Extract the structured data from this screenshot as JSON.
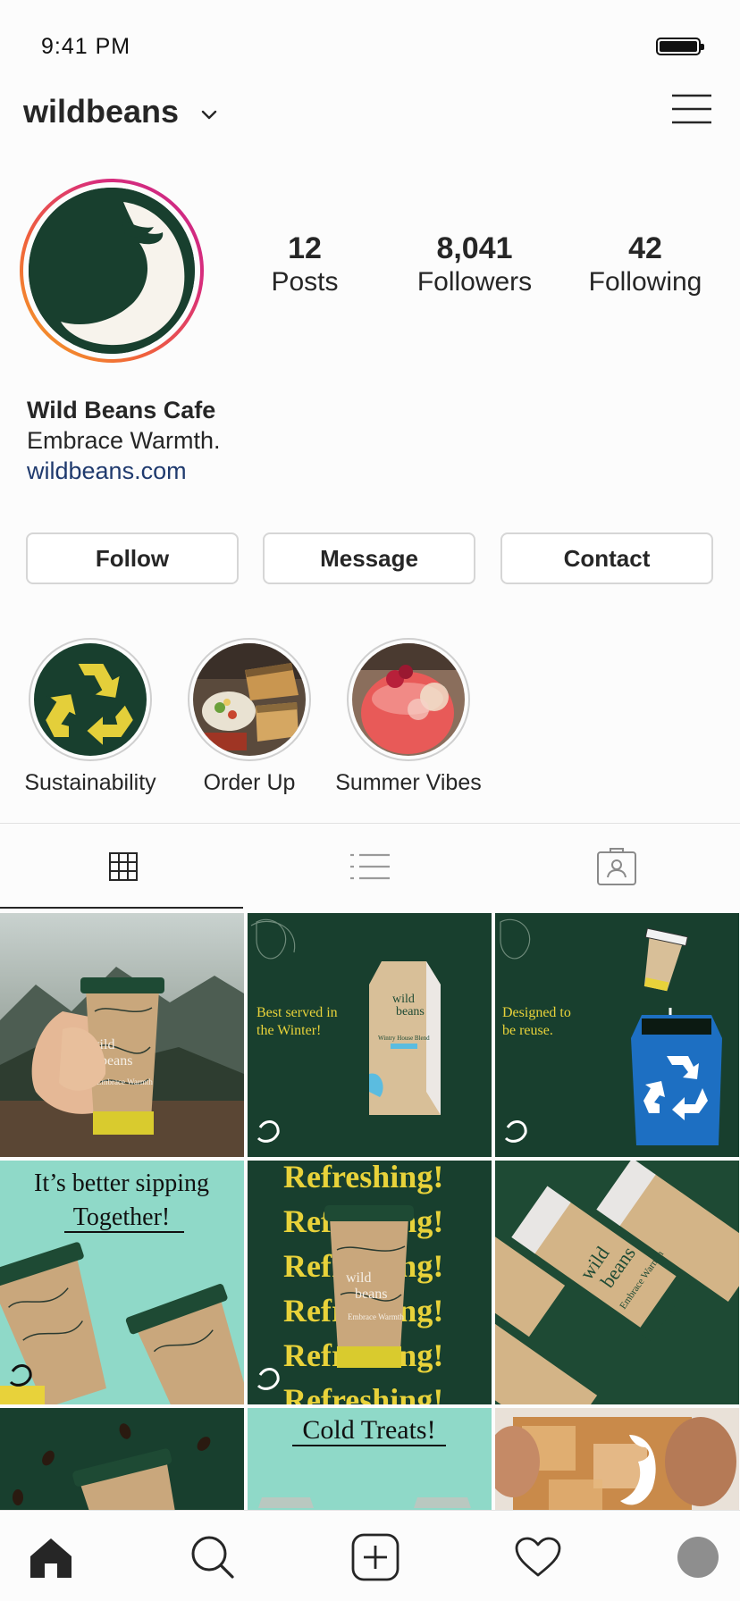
{
  "status_bar": {
    "time": "9:41 PM"
  },
  "header": {
    "username": "wildbeans"
  },
  "profile": {
    "stats": [
      {
        "number": "12",
        "label": "Posts"
      },
      {
        "number": "8,041",
        "label": "Followers"
      },
      {
        "number": "42",
        "label": "Following"
      }
    ],
    "name": "Wild Beans Cafe",
    "bio": "Embrace Warmth.",
    "link": "wildbeans.com"
  },
  "actions": {
    "follow": "Follow",
    "message": "Message",
    "contact": "Contact"
  },
  "highlights": [
    {
      "label": "Sustainability"
    },
    {
      "label": "Order Up"
    },
    {
      "label": "Summer Vibes"
    }
  ],
  "tabs": {
    "active": "grid",
    "icons": [
      "grid-icon",
      "list-icon",
      "tagged-icon"
    ]
  },
  "posts": {
    "p1": {
      "brand_line1": "wild",
      "brand_line2": "beans",
      "tagline": "Embrace Warmth"
    },
    "p2": {
      "headline_1": "Best served in",
      "headline_2": "the Winter!",
      "bag_brand_1": "wild",
      "bag_brand_2": "beans",
      "bag_label": "Wintry House Blend"
    },
    "p3": {
      "headline_1": "Designed to",
      "headline_2": "be reuse."
    },
    "p4": {
      "headline_1": "It’s better sipping",
      "headline_2": "Together!"
    },
    "p5": {
      "word": "Refreshing!",
      "brand_line1": "wild",
      "brand_line2": "beans",
      "tagline": "Embrace Warmth"
    },
    "p6": {
      "brand_line1": "wild",
      "brand_line2": "beans",
      "tagline": "Embrace Warmth"
    },
    "p8": {
      "headline": "Cold Treats!"
    }
  },
  "bottom_nav": {
    "icons": [
      "home-icon",
      "search-icon",
      "new-post-icon",
      "activity-icon",
      "profile-avatar"
    ]
  },
  "colors": {
    "brand_green": "#183f2e",
    "accent_yellow": "#e8d23a",
    "mint": "#8fd9c8",
    "link_blue": "#1f3a6e",
    "recycle_blue": "#1d6fc2",
    "kraft": "#c9a77c"
  }
}
